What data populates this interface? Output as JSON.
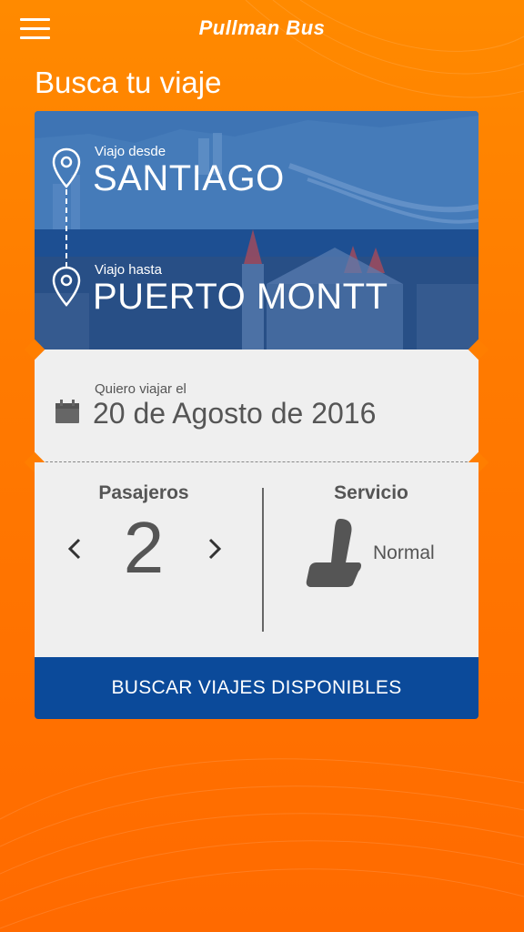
{
  "app": {
    "brand": "Pullman Bus"
  },
  "header": {
    "title": "Busca tu viaje"
  },
  "route": {
    "origin_label": "Viajo desde",
    "origin": "SANTIAGO",
    "destination_label": "Viajo hasta",
    "destination": "PUERTO MONTT"
  },
  "date": {
    "label": "Quiero viajar el",
    "value": "20 de Agosto de 2016"
  },
  "passengers": {
    "label": "Pasajeros",
    "count": "2"
  },
  "service": {
    "label": "Servicio",
    "value": "Normal"
  },
  "actions": {
    "search_label": "BUSCAR VIAJES DISPONIBLES"
  },
  "colors": {
    "background": "#ff7e00",
    "primary_button": "#0b4a9a",
    "card": "#efefef",
    "route_overlay": "#2e5f9e"
  },
  "icons": [
    "menu-icon",
    "location-pin-icon",
    "calendar-icon",
    "chevron-left-icon",
    "chevron-right-icon",
    "seat-icon"
  ]
}
